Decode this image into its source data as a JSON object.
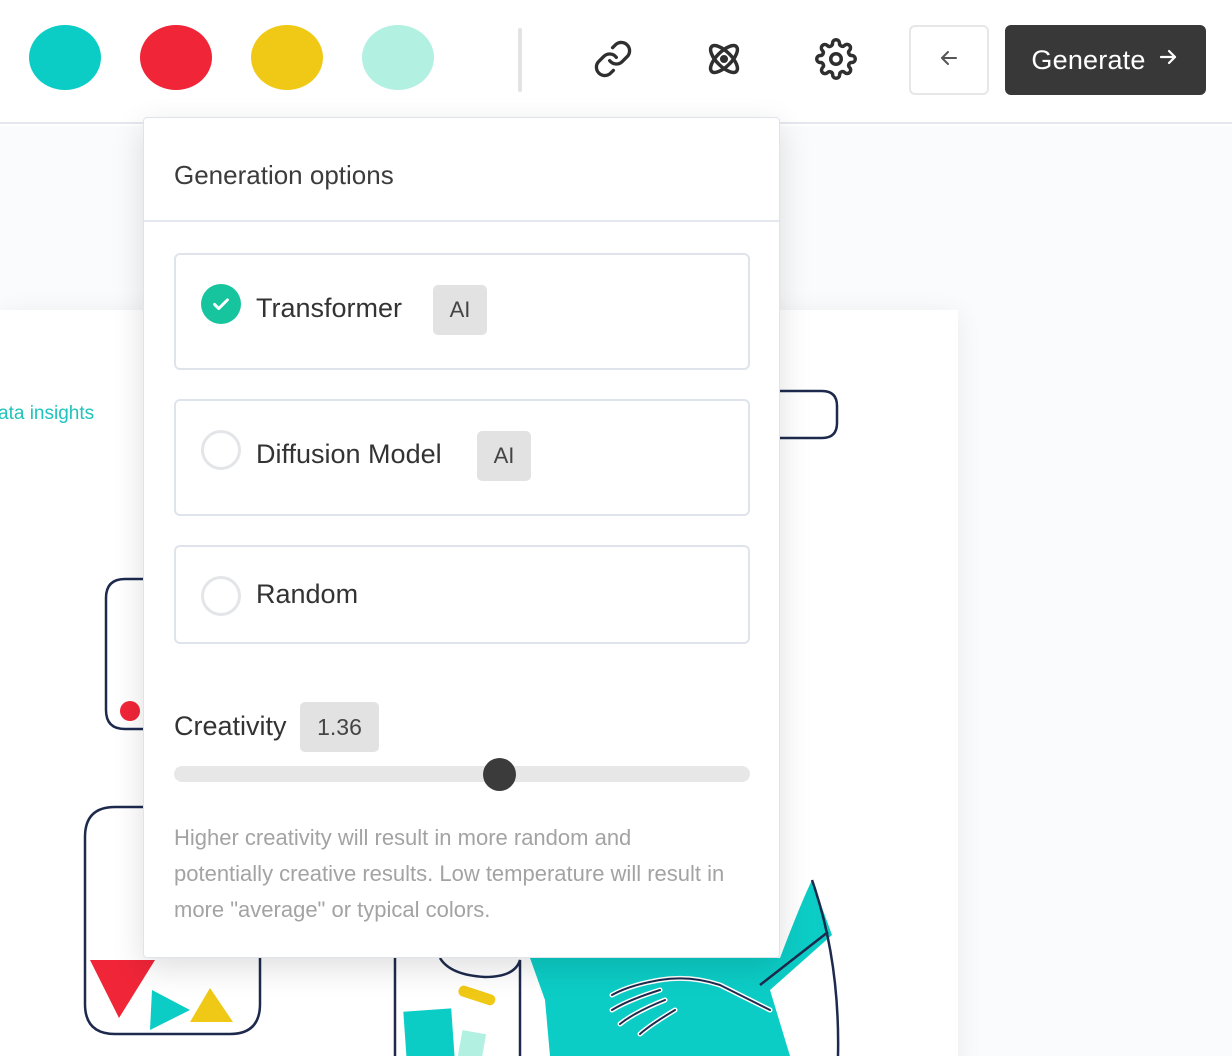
{
  "toolbar": {
    "swatches": [
      {
        "name": "teal",
        "color": "#0ccdc6"
      },
      {
        "name": "red",
        "color": "#f02538"
      },
      {
        "name": "yellow",
        "color": "#f0c916"
      },
      {
        "name": "mint",
        "color": "#b2f0e2"
      }
    ],
    "icons": [
      "link-icon",
      "atom-icon",
      "gear-icon",
      "arrow-left-icon"
    ],
    "generate_label": "Generate"
  },
  "background": {
    "insight_text": "ata insights"
  },
  "panel": {
    "title": "Generation options",
    "options": [
      {
        "label": "Transformer",
        "badge": "AI",
        "selected": true
      },
      {
        "label": "Diffusion Model",
        "badge": "AI",
        "selected": false
      },
      {
        "label": "Random",
        "badge": "",
        "selected": false
      }
    ],
    "creativity": {
      "label": "Creativity",
      "value": "1.36",
      "fraction": 0.565
    },
    "help_text": "Higher creativity will result in more random and potentially creative results. Low temperature will result in more \"average\" or typical colors."
  },
  "colors": {
    "accent_green": "#16c49e",
    "dark_button": "#383838",
    "teal": "#0ccdc6"
  }
}
